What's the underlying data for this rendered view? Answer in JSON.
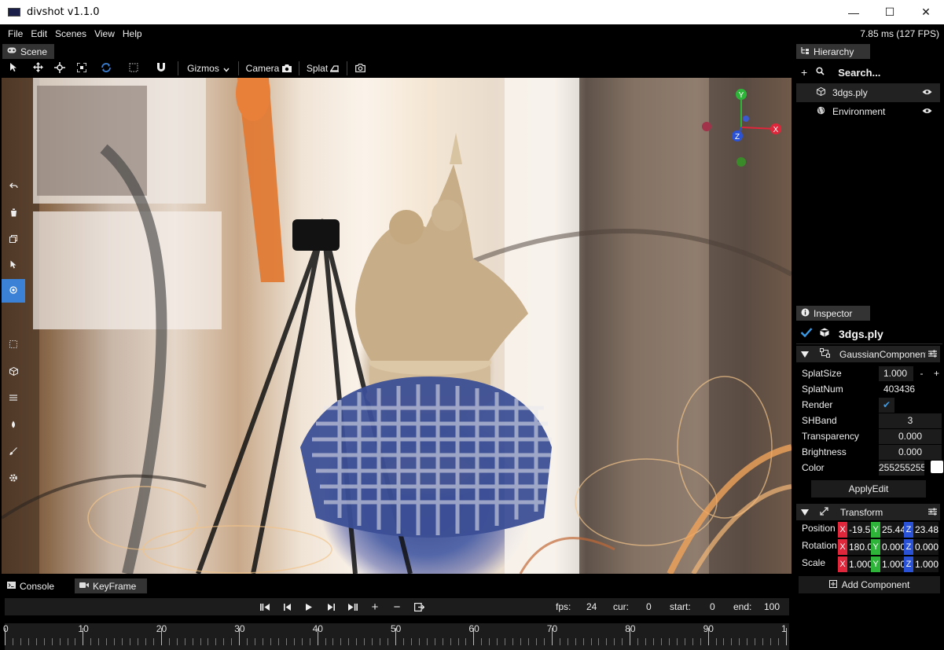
{
  "window": {
    "title": "divshot v1.1.0",
    "min": "—",
    "max": "☐",
    "close": "✕"
  },
  "menu": {
    "items": [
      "File",
      "Edit",
      "Scenes",
      "View",
      "Help"
    ],
    "perf": "7.85 ms (127 FPS)"
  },
  "scene_tab": {
    "label": "Scene",
    "icon": "gamepad-icon"
  },
  "toolbar": {
    "gizmos": "Gizmos",
    "camera": "Camera",
    "splat": "Splat"
  },
  "hierarchy": {
    "tab": "Hierarchy",
    "search_placeholder": "Search...",
    "items": [
      {
        "label": "3dgs.ply",
        "icon": "cube-icon",
        "visible": true
      },
      {
        "label": "Environment",
        "icon": "globe-icon",
        "visible": true
      }
    ]
  },
  "inspector": {
    "tab": "Inspector",
    "object_name": "3dgs.ply",
    "gaussian": {
      "header": "GaussianComponent",
      "fields": [
        {
          "label": "SplatSize",
          "value": "1.000",
          "minus": "-",
          "plus": "+"
        },
        {
          "label": "SplatNum",
          "value": "403436"
        },
        {
          "label": "Render",
          "value": "✔"
        },
        {
          "label": "SHBand",
          "value": "3"
        },
        {
          "label": "Transparency",
          "value": "0.000"
        },
        {
          "label": "Brightness",
          "value": "0.000"
        },
        {
          "label": "Color",
          "value": "255255255"
        }
      ],
      "apply": "ApplyEdit"
    },
    "transform": {
      "header": "Transform",
      "rows": [
        {
          "label": "Position",
          "x": "-19.5",
          "y": "25.44",
          "z": "23.48"
        },
        {
          "label": "Rotation",
          "x": "180.0",
          "y": "0.000",
          "z": "0.000"
        },
        {
          "label": "Scale",
          "x": "1.000",
          "y": "1.000",
          "z": "1.000"
        }
      ]
    },
    "add_component": "Add Component"
  },
  "bottom": {
    "tabs": [
      "Console",
      "KeyFrame"
    ],
    "fps_label": "fps:",
    "fps": "24",
    "cur_label": "cur:",
    "cur": "0",
    "start_label": "start:",
    "start": "0",
    "end_label": "end:",
    "end": "100",
    "timeline_labels": [
      "0",
      "10",
      "20",
      "30",
      "40",
      "50",
      "60",
      "70",
      "80",
      "90",
      "1"
    ]
  },
  "colors": {
    "accent": "#3b82d6",
    "axis_x": "#e0263a",
    "axis_y": "#2fb43a",
    "axis_z": "#2a52d6"
  },
  "gizmo": {
    "x": "X",
    "y": "Y",
    "z": "Z"
  }
}
